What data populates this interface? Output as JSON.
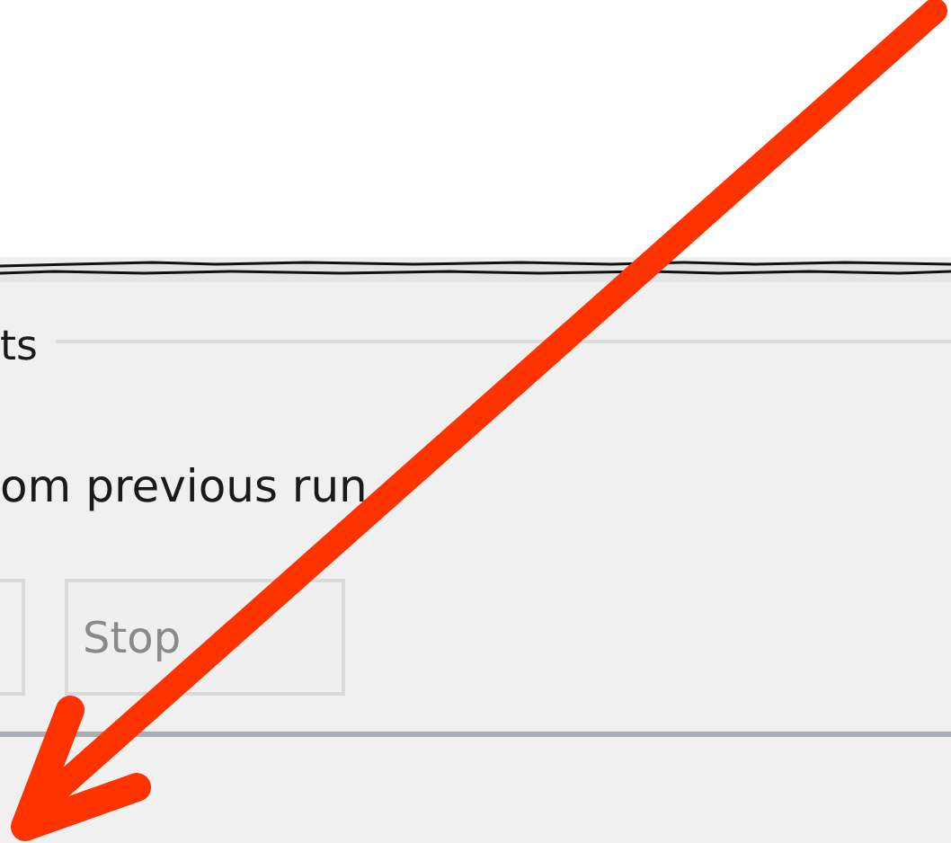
{
  "group": {
    "label": "ts"
  },
  "option": {
    "label": "om previous run"
  },
  "buttons": [
    {
      "label": "Stop",
      "disabled": true
    }
  ]
}
